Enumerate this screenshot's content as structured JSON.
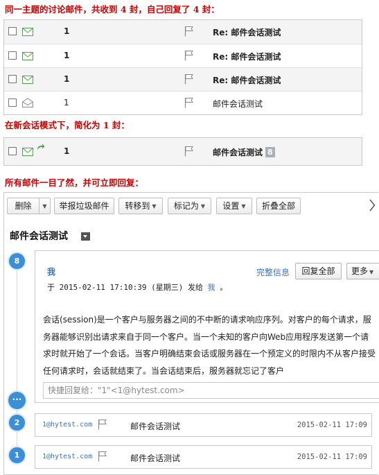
{
  "captions": {
    "thread": "同一主题的讨论邮件，共收到 4 封，自己回复了 4 封：",
    "conversation_mode": "在新会话模式下，简化为 1 封：",
    "all_mail": "所有邮件一目了然，并可立即回复："
  },
  "thread_list": [
    {
      "count": "1",
      "subject": "Re: 邮件会话测试",
      "bold": true,
      "icon": "envelope-icon"
    },
    {
      "count": "1",
      "subject": "Re: 邮件会话测试",
      "bold": true,
      "icon": "envelope-icon"
    },
    {
      "count": "1",
      "subject": "Re: 邮件会话测试",
      "bold": true,
      "icon": "envelope-icon"
    },
    {
      "count": "1",
      "subject": "邮件会话测试",
      "bold": false,
      "icon": "open-envelope-icon"
    }
  ],
  "conversation_row": {
    "count": "1",
    "subject": "邮件会话测试",
    "badge": "8"
  },
  "toolbar": {
    "delete": "删除",
    "report_spam": "举报垃圾邮件",
    "move_to": "转移到",
    "mark_as": "标记为",
    "settings": "设置",
    "collapse_all": "折叠全部"
  },
  "conversation": {
    "title": "邮件会话测试",
    "latest": {
      "number": "8",
      "sender": "我",
      "sent_prefix": "于 2015-02-11 17:10:39 (星期三) 发给",
      "sent_to": "我",
      "sent_suffix": "。",
      "full_info": "完整信息",
      "reply_all": "回复全部",
      "more": "更多",
      "body": "会话(session)是一个客户与服务器之间的不中断的请求响应序列。对客户的每个请求，服务器能够识别出请求来自于同一个客户。当一个未知的客户向Web应用程序发送第一个请求时就开始了一个会话。当客户明确结束会话或服务器在一个预定义的时限内不从客户接受任何请求时，会话就结束了。当会话结束后，服务器就忘记了客户",
      "quick_reply_placeholder": "快捷回复给：\"1\"<1@hytest.com>",
      "expand_more": "···"
    },
    "collapsed": [
      {
        "number": "2",
        "from": "1@hytest.com",
        "subject": "邮件会话测试",
        "date": "2015-02-11 17:09"
      },
      {
        "number": "1",
        "from": "1@hytest.com",
        "subject": "邮件会话测试",
        "date": "2015-02-11 17:09"
      }
    ]
  },
  "colors": {
    "caption_red": "#cc0000",
    "link_blue": "#3a73c4",
    "timeline_blue": "#3a8fd6",
    "envelope_green": "#4aa64a"
  }
}
